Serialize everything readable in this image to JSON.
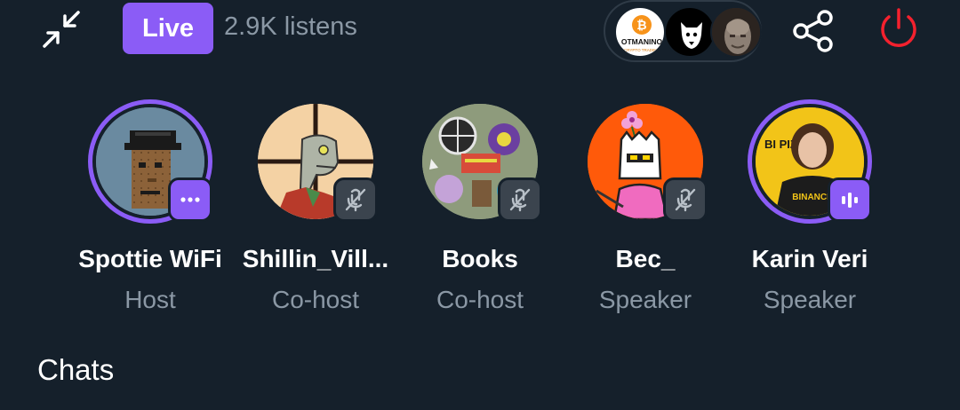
{
  "header": {
    "live_label": "Live",
    "listens_text": "2.9K listens",
    "minimize_icon": "minimize-arrows-icon",
    "share_icon": "share-icon",
    "leave_icon": "power-icon",
    "leave_color": "#f4212e",
    "listener_avatars": [
      {
        "name": "listener-avatar-1",
        "logo_text": "OTMANINO",
        "logo_subtext": "CRYPTO TRADING"
      },
      {
        "name": "listener-avatar-2"
      },
      {
        "name": "listener-avatar-3"
      }
    ]
  },
  "participants": [
    {
      "name": "Spottie WiFi",
      "role": "Host",
      "status": "more",
      "speaking_ring": true
    },
    {
      "name": "Shillin_Vill...",
      "role": "Co-host",
      "status": "muted",
      "speaking_ring": false
    },
    {
      "name": "Books",
      "role": "Co-host",
      "status": "muted",
      "speaking_ring": false
    },
    {
      "name": "Bec_",
      "role": "Speaker",
      "status": "muted",
      "speaking_ring": false
    },
    {
      "name": "Karin Veri",
      "role": "Speaker",
      "status": "speaking",
      "speaking_ring": true,
      "shirt_text": "BINANCE",
      "banner_text": "BI PIZZA"
    }
  ],
  "chats": {
    "heading": "Chats"
  },
  "colors": {
    "background": "#15202b",
    "accent": "#8b5cf6",
    "muted_text": "#8b98a5",
    "badge_gray": "#3b444e"
  }
}
